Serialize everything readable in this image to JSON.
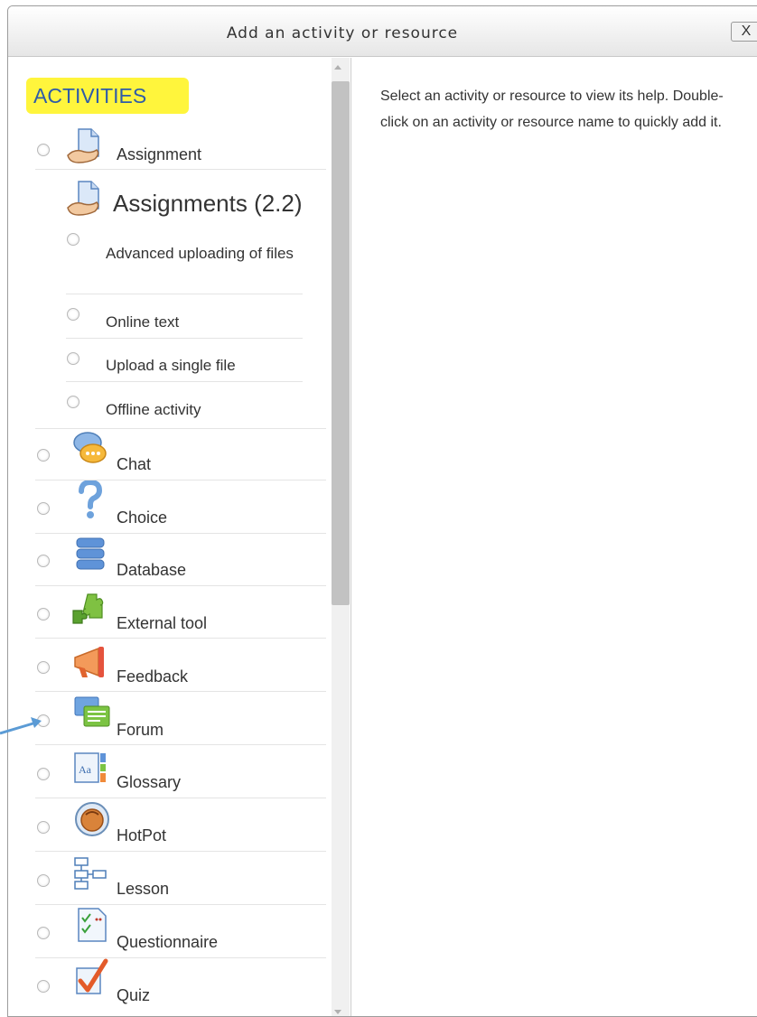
{
  "dialog": {
    "title": "Add an activity or resource",
    "close_label": "X"
  },
  "activities": {
    "heading": "ACTIVITIES",
    "heading_highlight_color": "#fff53c",
    "items": [
      {
        "label": "Assignment",
        "icon": "assignment-icon"
      },
      {
        "label": "Chat",
        "icon": "chat-icon"
      },
      {
        "label": "Choice",
        "icon": "choice-icon"
      },
      {
        "label": "Database",
        "icon": "database-icon"
      },
      {
        "label": "External tool",
        "icon": "external-tool-icon"
      },
      {
        "label": "Feedback",
        "icon": "feedback-icon"
      },
      {
        "label": "Forum",
        "icon": "forum-icon"
      },
      {
        "label": "Glossary",
        "icon": "glossary-icon"
      },
      {
        "label": "HotPot",
        "icon": "hotpot-icon"
      },
      {
        "label": "Lesson",
        "icon": "lesson-icon"
      },
      {
        "label": "Questionnaire",
        "icon": "questionnaire-icon"
      },
      {
        "label": "Quiz",
        "icon": "quiz-icon"
      }
    ],
    "assignments_group": {
      "title": "Assignments (2.2)",
      "icon": "assignment-icon",
      "subitems": [
        {
          "label": "Advanced uploading of files"
        },
        {
          "label": "Online text"
        },
        {
          "label": "Upload a single file"
        },
        {
          "label": "Offline activity"
        }
      ]
    }
  },
  "help": {
    "text": "Select an activity or resource to view its help. Double-click on an activity or resource name to quickly add it."
  },
  "colors": {
    "heading_text": "#2f5ca8",
    "annotation_arrow": "#5b9bd5"
  }
}
